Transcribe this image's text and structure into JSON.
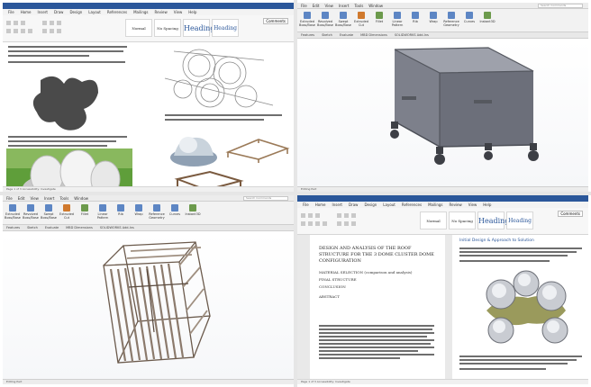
{
  "word": {
    "menu": [
      "File",
      "Home",
      "Insert",
      "Draw",
      "Design",
      "Layout",
      "References",
      "Mailings",
      "Review",
      "View",
      "Help"
    ],
    "styles": [
      "Normal",
      "No Spacing",
      "Heading",
      "Heading 2"
    ],
    "share": "Share",
    "comments": "Comments",
    "doc1": {
      "caption_top": "The third set of the design layout features three outer openings, ...",
      "caption_mid": "The structure was initially developed from modular ...",
      "caption_right": "The third set of 3D renders show..."
    },
    "doc2": {
      "heading": "DESIGN AND ANALYSIS OF THE ROOF STRUCTURE FOR THE 3 DOME CLUSTER DOME CONFIGURATION",
      "lines": [
        "MATERIAL SELECTION (comparison and analysis)",
        "FINAL STRUCTURE",
        "CONCLUSION"
      ],
      "abstract": "ABSTRACT",
      "side_heading": "Initial Design & Approach to Solution"
    },
    "status": "Page 1 of 3   Accessibility: Investigate"
  },
  "cad": {
    "menu": [
      "File",
      "Edit",
      "View",
      "Insert",
      "Tools",
      "Window"
    ],
    "search_placeholder": "Search Commands",
    "tabs": [
      "Features",
      "Sketch",
      "Evaluate",
      "MBD Dimensions",
      "SOLIDWORKS Add-Ins"
    ],
    "buttons": [
      "Extruded Boss/Base",
      "Revolved Boss/Base",
      "Swept Boss/Base",
      "Extruded Cut",
      "Fillet",
      "Linear Pattern",
      "Rib",
      "Wrap",
      "Reference Geometry",
      "Curves",
      "Instant3D"
    ],
    "status": "Editing Part"
  },
  "colors": {
    "word_blue": "#2b579a",
    "cad_blue": "#5d86c4",
    "cad_orange": "#d0792d",
    "steel": "#8b8d97",
    "wood": "#7a5a3f"
  }
}
